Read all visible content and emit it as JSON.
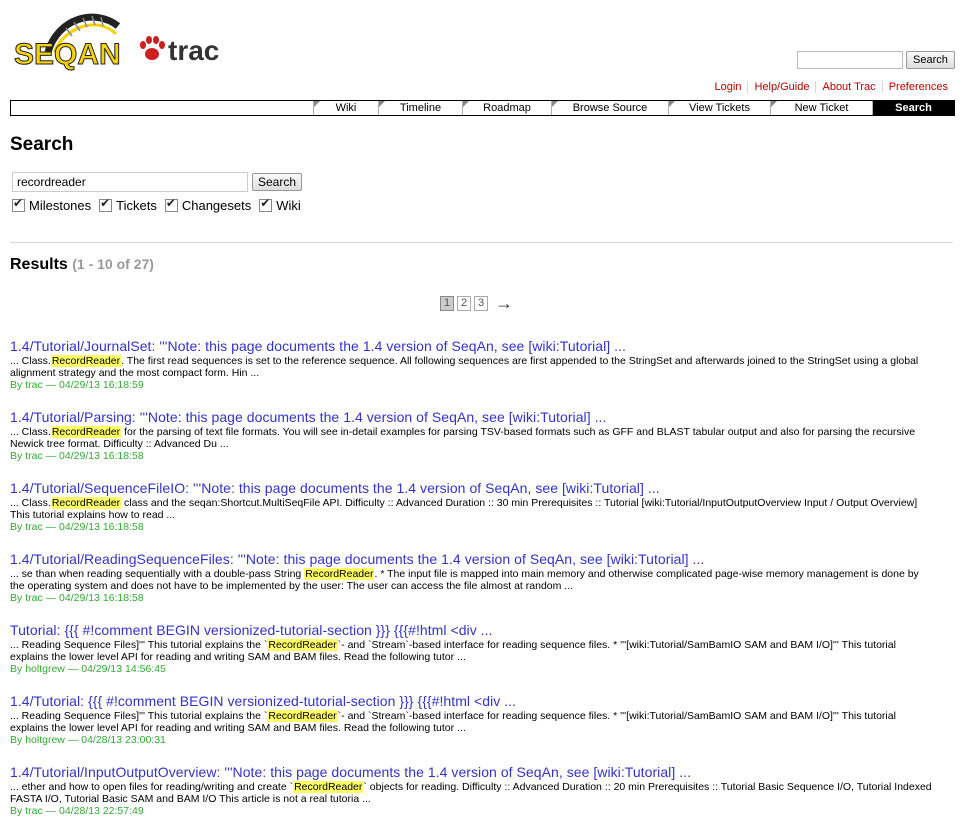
{
  "logo": {
    "text_1": "SEQAN",
    "text_2": "trac"
  },
  "top_search": {
    "value": "",
    "button": "Search"
  },
  "metanav": [
    "Login",
    "Help/Guide",
    "About Trac",
    "Preferences"
  ],
  "mainnav": [
    "Wiki",
    "Timeline",
    "Roadmap",
    "Browse Source",
    "View Tickets",
    "New Ticket",
    "Search"
  ],
  "page": {
    "title": "Search",
    "query": "recordreader",
    "search_button": "Search",
    "filters": [
      "Milestones",
      "Tickets",
      "Changesets",
      "Wiki"
    ],
    "results_label": "Results",
    "results_count": "(1 - 10 of 27)",
    "pager": {
      "pages": [
        "1",
        "2",
        "3"
      ],
      "current": "1",
      "next": "→"
    }
  },
  "results": [
    {
      "title": "1.4/Tutorial/JournalSet: '''Note: this page documents the 1.4 version of SeqAn, see [wiki:Tutorial] ...",
      "ex_pre": "... Class.",
      "ex_hl": "RecordReader",
      "ex_post": ". The first read sequences is set to the reference sequence. All following sequences are first appended to the StringSet and afterwards joined to the StringSet using a global alignment strategy and the most compact form. Hin ...",
      "by": "By",
      "author": "trac",
      "date": "— 04/29/13 16:18:59"
    },
    {
      "title": "1.4/Tutorial/Parsing: '''Note: this page documents the 1.4 version of SeqAn, see [wiki:Tutorial] ...",
      "ex_pre": "... Class.",
      "ex_hl": "RecordReader",
      "ex_post": " for the parsing of text file formats. You will see in-detail examples for parsing TSV-based formats such as GFF and BLAST tabular output and also for parsing the recursive Newick tree format. Difficulty :: Advanced Du ...",
      "by": "By",
      "author": "trac",
      "date": "— 04/29/13 16:18:58"
    },
    {
      "title": "1.4/Tutorial/SequenceFileIO: '''Note: this page documents the 1.4 version of SeqAn, see [wiki:Tutorial] ...",
      "ex_pre": "... Class.",
      "ex_hl": "RecordReader",
      "ex_post": " class and the seqan:Shortcut.MultiSeqFile API. Difficulty :: Advanced Duration :: 30 min Prerequisites :: Tutorial [wiki:Tutorial/InputOutputOverview Input / Output Overview] This tutorial explains how to read ...",
      "by": "By",
      "author": "trac",
      "date": "— 04/29/13 16:18:58"
    },
    {
      "title": "1.4/Tutorial/ReadingSequenceFiles: '''Note: this page documents the 1.4 version of SeqAn, see [wiki:Tutorial] ...",
      "ex_pre": "... se than when reading sequentially with a double-pass String ",
      "ex_hl": "RecordReader",
      "ex_post": ". * The input file is mapped into main memory and otherwise complicated page-wise memory management is done by the operating system and does not have to be implemented by the user: The user can access the file almost at random ...",
      "by": "By",
      "author": "trac",
      "date": "— 04/29/13 16:18:58"
    },
    {
      "title": "Tutorial: {{{ #!comment BEGIN versionized-tutorial-section }}} {{{#!html <div ...",
      "ex_pre": "... Reading Sequence Files]''' This tutorial explains the `",
      "ex_hl": "RecordReader",
      "ex_post": "`- and `Stream`-based interface for reading sequence files. * '''[wiki:Tutorial/SamBamIO SAM and BAM I/O]''' This tutorial explains the lower level API for reading and writing SAM and BAM files. Read the following tutor ...",
      "by": "By",
      "author": "holtgrew",
      "date": "— 04/29/13 14:56:45"
    },
    {
      "title": "1.4/Tutorial: {{{ #!comment BEGIN versionized-tutorial-section }}} {{{#!html <div ...",
      "ex_pre": "... Reading Sequence Files]''' This tutorial explains the `",
      "ex_hl": "RecordReader",
      "ex_post": "`- and `Stream`-based interface for reading sequence files. * '''[wiki:Tutorial/SamBamIO SAM and BAM I/O]''' This tutorial explains the lower level API for reading and writing SAM and BAM files. Read the following tutor ...",
      "by": "By",
      "author": "holtgrew",
      "date": "— 04/28/13 23:00:31"
    },
    {
      "title": "1.4/Tutorial/InputOutputOverview: '''Note: this page documents the 1.4 version of SeqAn, see [wiki:Tutorial] ...",
      "ex_pre": "... ether and how to open files for reading/writing and create `",
      "ex_hl": "RecordReader",
      "ex_post": "` objects for reading. Difficulty :: Advanced Duration :: 20 min Prerequisites :: Tutorial Basic Sequence I/O, Tutorial Indexed FASTA I/O, Tutorial Basic SAM and BAM I/O This article is not a real tutoria ...",
      "by": "By",
      "author": "trac",
      "date": "— 04/28/13 22:57:49"
    }
  ],
  "colors": {
    "link_blue": "#3333cc",
    "meta_green": "#33aa33",
    "metanav_red": "#bb0000",
    "highlight": "#ffff66",
    "logo_yellow": "#f5d300",
    "logo_red": "#cc1f1f"
  }
}
